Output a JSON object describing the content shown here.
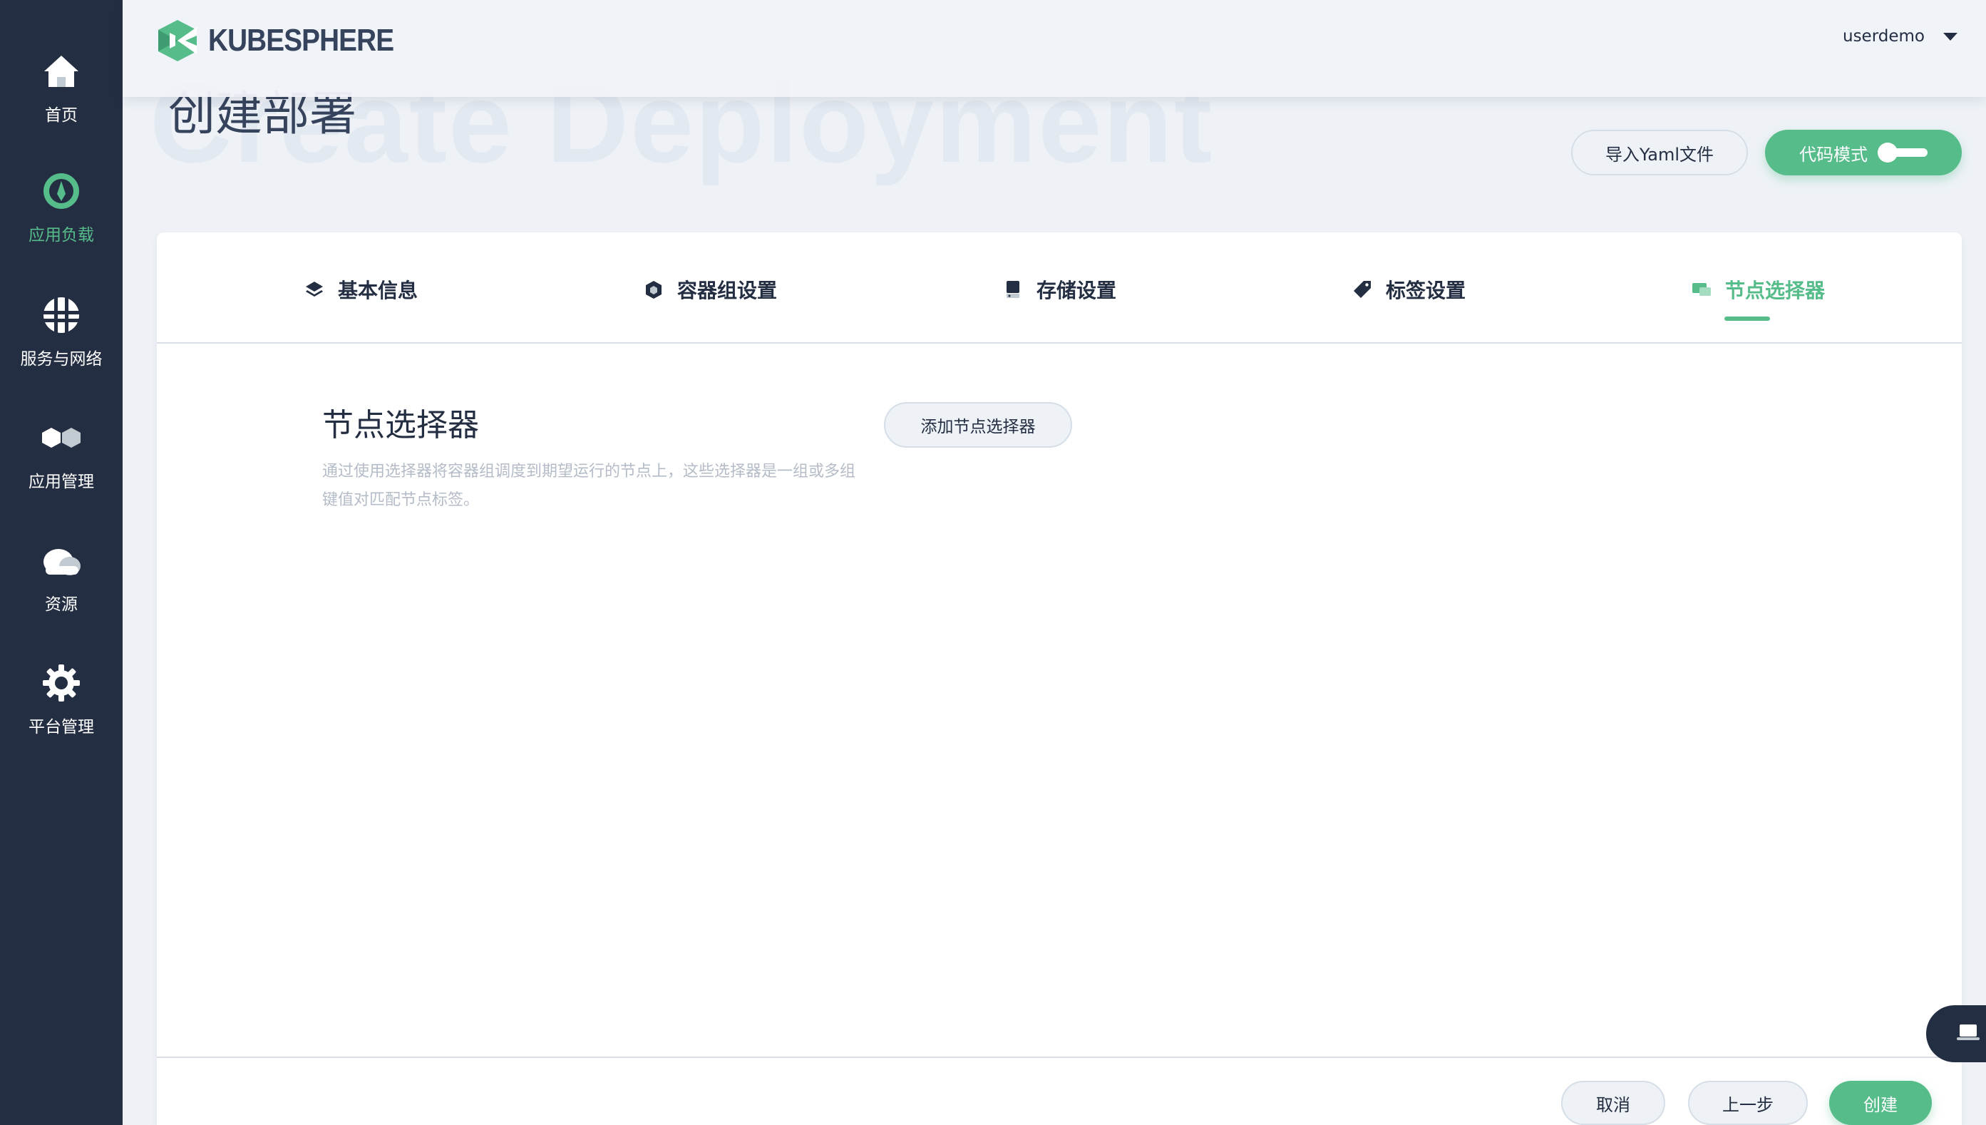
{
  "sidebar": {
    "items": [
      {
        "label": "首页",
        "icon": "home-icon",
        "active": false
      },
      {
        "label": "应用负载",
        "icon": "workload-icon",
        "active": true
      },
      {
        "label": "服务与网络",
        "icon": "network-icon",
        "active": false
      },
      {
        "label": "应用管理",
        "icon": "app-management-icon",
        "active": false
      },
      {
        "label": "资源",
        "icon": "cloud-icon",
        "active": false
      },
      {
        "label": "平台管理",
        "icon": "gear-icon",
        "active": false
      }
    ]
  },
  "header": {
    "logo_text": "KUBESPHERE",
    "username": "userdemo"
  },
  "page": {
    "title": "创建部署",
    "background_title": "Create Deployment"
  },
  "actions": {
    "import_yaml": "导入Yaml文件",
    "code_mode": "代码模式",
    "code_mode_on": false
  },
  "tabs": [
    {
      "label": "基本信息",
      "icon": "layers-icon",
      "active": false
    },
    {
      "label": "容器组设置",
      "icon": "container-icon",
      "active": false
    },
    {
      "label": "存储设置",
      "icon": "storage-icon",
      "active": false
    },
    {
      "label": "标签设置",
      "icon": "tag-icon",
      "active": false
    },
    {
      "label": "节点选择器",
      "icon": "node-icon",
      "active": true
    }
  ],
  "section": {
    "title": "节点选择器",
    "description": "通过使用选择器将容器组调度到期望运行的节点上，这些选择器是一组或多组键值对匹配节点标签。",
    "add_button": "添加节点选择器"
  },
  "footer": {
    "cancel": "取消",
    "previous": "上一步",
    "create": "创建"
  },
  "colors": {
    "accent": "#55bc8a",
    "sidebar_bg": "#242e42",
    "page_bg": "#eef2f7"
  }
}
